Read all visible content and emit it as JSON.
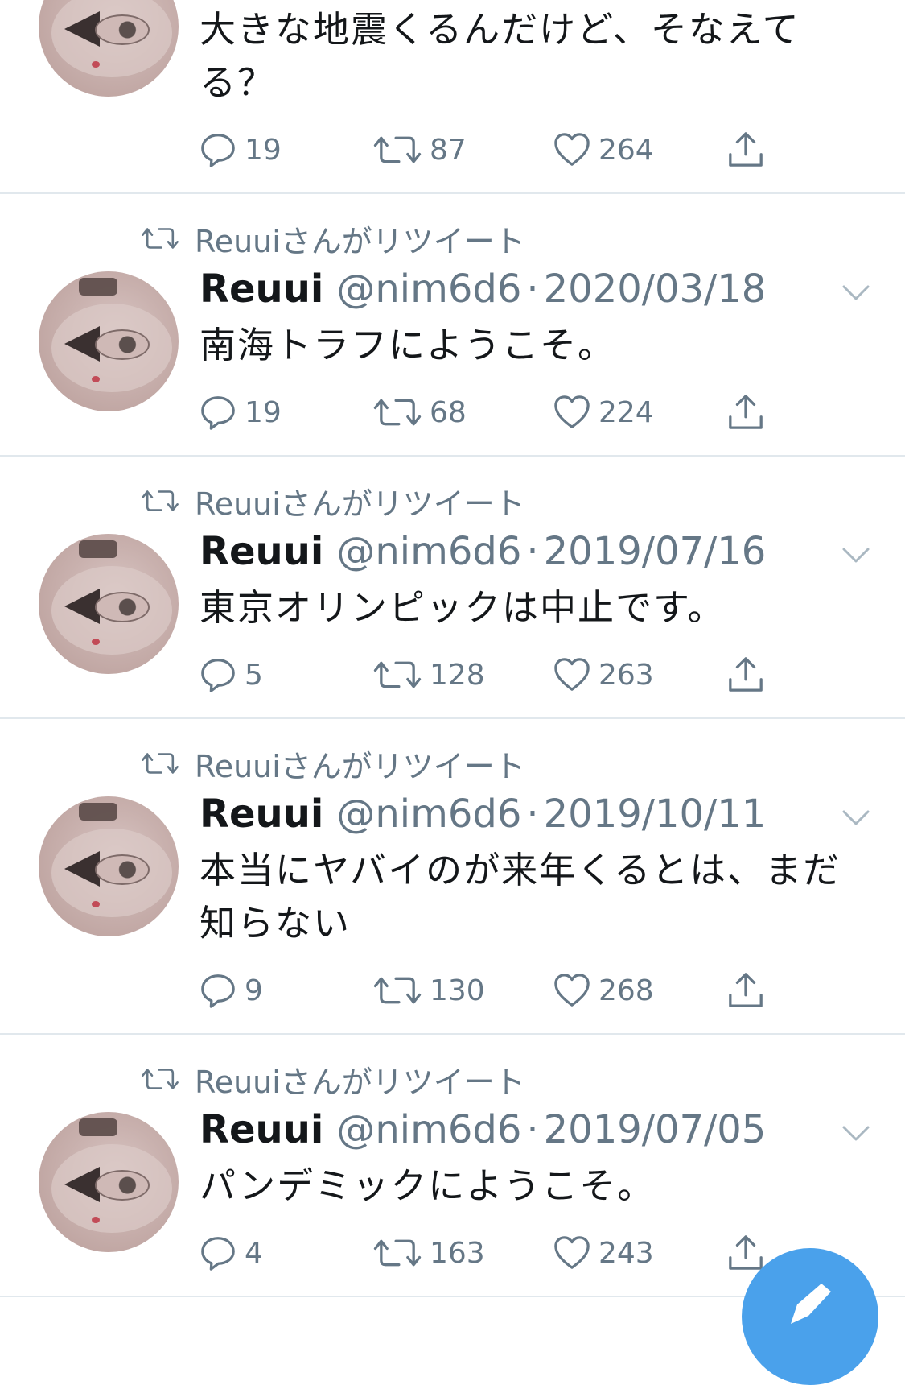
{
  "colors": {
    "text": "#14171a",
    "muted": "#657786",
    "divider": "#e1e8ed",
    "accent": "#4aa1eb"
  },
  "icons": {
    "reply": "reply-icon",
    "retweet": "retweet-icon",
    "like": "heart-icon",
    "share": "share-icon",
    "more": "chevron-down-icon",
    "compose": "compose-icon"
  },
  "tweets": [
    {
      "retweet_label": "",
      "name": "",
      "handle": "",
      "date": "",
      "text": "大きな地震くるんだけど、そなえて\nる？",
      "replies": "19",
      "retweets": "87",
      "likes": "264"
    },
    {
      "retweet_label": "Reuuiさんがリツイート",
      "name": "Reuui",
      "handle": "@nim6d6",
      "date": "2020/03/18",
      "text": "南海トラフにようこそ。",
      "replies": "19",
      "retweets": "68",
      "likes": "224"
    },
    {
      "retweet_label": "Reuuiさんがリツイート",
      "name": "Reuui",
      "handle": "@nim6d6",
      "date": "2019/07/16",
      "text": "東京オリンピックは中止です。",
      "replies": "5",
      "retweets": "128",
      "likes": "263"
    },
    {
      "retweet_label": "Reuuiさんがリツイート",
      "name": "Reuui",
      "handle": "@nim6d6",
      "date": "2019/10/11",
      "text": "本当にヤバイのが来年くるとは、まだ\n知らない",
      "replies": "9",
      "retweets": "130",
      "likes": "268"
    },
    {
      "retweet_label": "Reuuiさんがリツイート",
      "name": "Reuui",
      "handle": "@nim6d6",
      "date": "2019/07/05",
      "text": "パンデミックにようこそ。",
      "replies": "4",
      "retweets": "163",
      "likes": "243"
    }
  ]
}
